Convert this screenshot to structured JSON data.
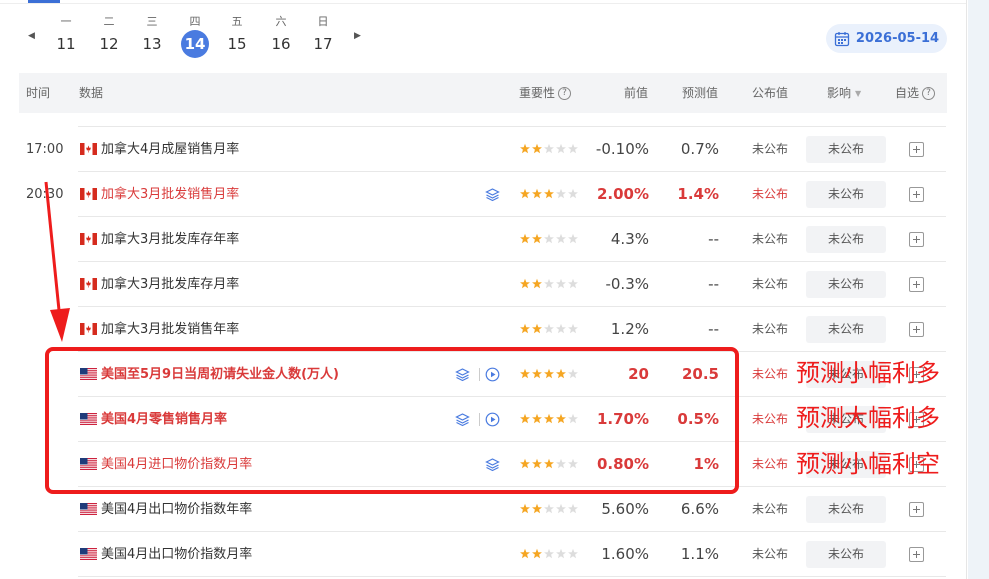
{
  "week": [
    {
      "weekday": "一",
      "day": "11",
      "selected": false
    },
    {
      "weekday": "二",
      "day": "12",
      "selected": false
    },
    {
      "weekday": "三",
      "day": "13",
      "selected": false
    },
    {
      "weekday": "四",
      "day": "14",
      "selected": true
    },
    {
      "weekday": "五",
      "day": "15",
      "selected": false
    },
    {
      "weekday": "六",
      "day": "16",
      "selected": false
    },
    {
      "weekday": "日",
      "day": "17",
      "selected": false
    }
  ],
  "nav": {
    "prev_glyph": "◀",
    "next_glyph": "▶"
  },
  "date_picker": {
    "value": "2026-05-14",
    "icon": "calendar-icon"
  },
  "columns": {
    "time": "时间",
    "data": "数据",
    "importance": "重要性",
    "previous": "前值",
    "forecast": "预测值",
    "actual": "公布值",
    "impact": "影响",
    "watch": "自选",
    "help_glyph": "?",
    "sort_glyph": "▼"
  },
  "rows": [
    {
      "time": "17:00",
      "flag": "canada-flag",
      "name": "加拿大4月成屋销售月率",
      "stars": 2,
      "previous": "-0.10%",
      "forecast": "0.7%",
      "actual": "未公布",
      "impact": "未公布",
      "highlight": false,
      "bold": false,
      "icons": []
    },
    {
      "time": "20:30",
      "flag": "canada-flag",
      "name": "加拿大3月批发销售月率",
      "stars": 3,
      "previous": "2.00%",
      "forecast": "1.4%",
      "actual": "未公布",
      "impact": "未公布",
      "highlight": true,
      "bold": false,
      "icons": [
        "layers-icon"
      ]
    },
    {
      "time": "",
      "flag": "canada-flag",
      "name": "加拿大3月批发库存年率",
      "stars": 2,
      "previous": "4.3%",
      "forecast": "--",
      "actual": "未公布",
      "impact": "未公布",
      "highlight": false,
      "bold": false,
      "icons": []
    },
    {
      "time": "",
      "flag": "canada-flag",
      "name": "加拿大3月批发库存月率",
      "stars": 2,
      "previous": "-0.3%",
      "forecast": "--",
      "actual": "未公布",
      "impact": "未公布",
      "highlight": false,
      "bold": false,
      "icons": []
    },
    {
      "time": "",
      "flag": "canada-flag",
      "name": "加拿大3月批发销售年率",
      "stars": 2,
      "previous": "1.2%",
      "forecast": "--",
      "actual": "未公布",
      "impact": "未公布",
      "highlight": false,
      "bold": false,
      "icons": []
    },
    {
      "time": "",
      "flag": "us-flag",
      "name": "美国至5月9日当周初请失业金人数(万人)",
      "stars": 4,
      "previous": "20",
      "forecast": "20.5",
      "actual": "未公布",
      "impact": "未公布",
      "highlight": true,
      "bold": true,
      "icons": [
        "layers-icon",
        "play-icon"
      ]
    },
    {
      "time": "",
      "flag": "us-flag",
      "name": "美国4月零售销售月率",
      "stars": 4,
      "previous": "1.70%",
      "forecast": "0.5%",
      "actual": "未公布",
      "impact": "未公布",
      "highlight": true,
      "bold": true,
      "icons": [
        "layers-icon",
        "play-icon"
      ]
    },
    {
      "time": "",
      "flag": "us-flag",
      "name": "美国4月进口物价指数月率",
      "stars": 3,
      "previous": "0.80%",
      "forecast": "1%",
      "actual": "未公布",
      "impact": "未公布",
      "highlight": true,
      "bold": false,
      "icons": [
        "layers-icon"
      ]
    },
    {
      "time": "",
      "flag": "us-flag",
      "name": "美国4月出口物价指数年率",
      "stars": 2,
      "previous": "5.60%",
      "forecast": "6.6%",
      "actual": "未公布",
      "impact": "未公布",
      "highlight": false,
      "bold": false,
      "icons": []
    },
    {
      "time": "",
      "flag": "us-flag",
      "name": "美国4月出口物价指数月率",
      "stars": 2,
      "previous": "1.60%",
      "forecast": "1.1%",
      "actual": "未公布",
      "impact": "未公布",
      "highlight": false,
      "bold": false,
      "icons": []
    }
  ],
  "annotations": [
    "预测小幅利多",
    "预测大幅利多",
    "预测小幅利空"
  ],
  "colors": {
    "accent": "#4a7be0",
    "highlight": "#d93a3a",
    "annotation": "#ee1c1c",
    "star_on": "#f5a623",
    "star_off": "#dddddd"
  }
}
